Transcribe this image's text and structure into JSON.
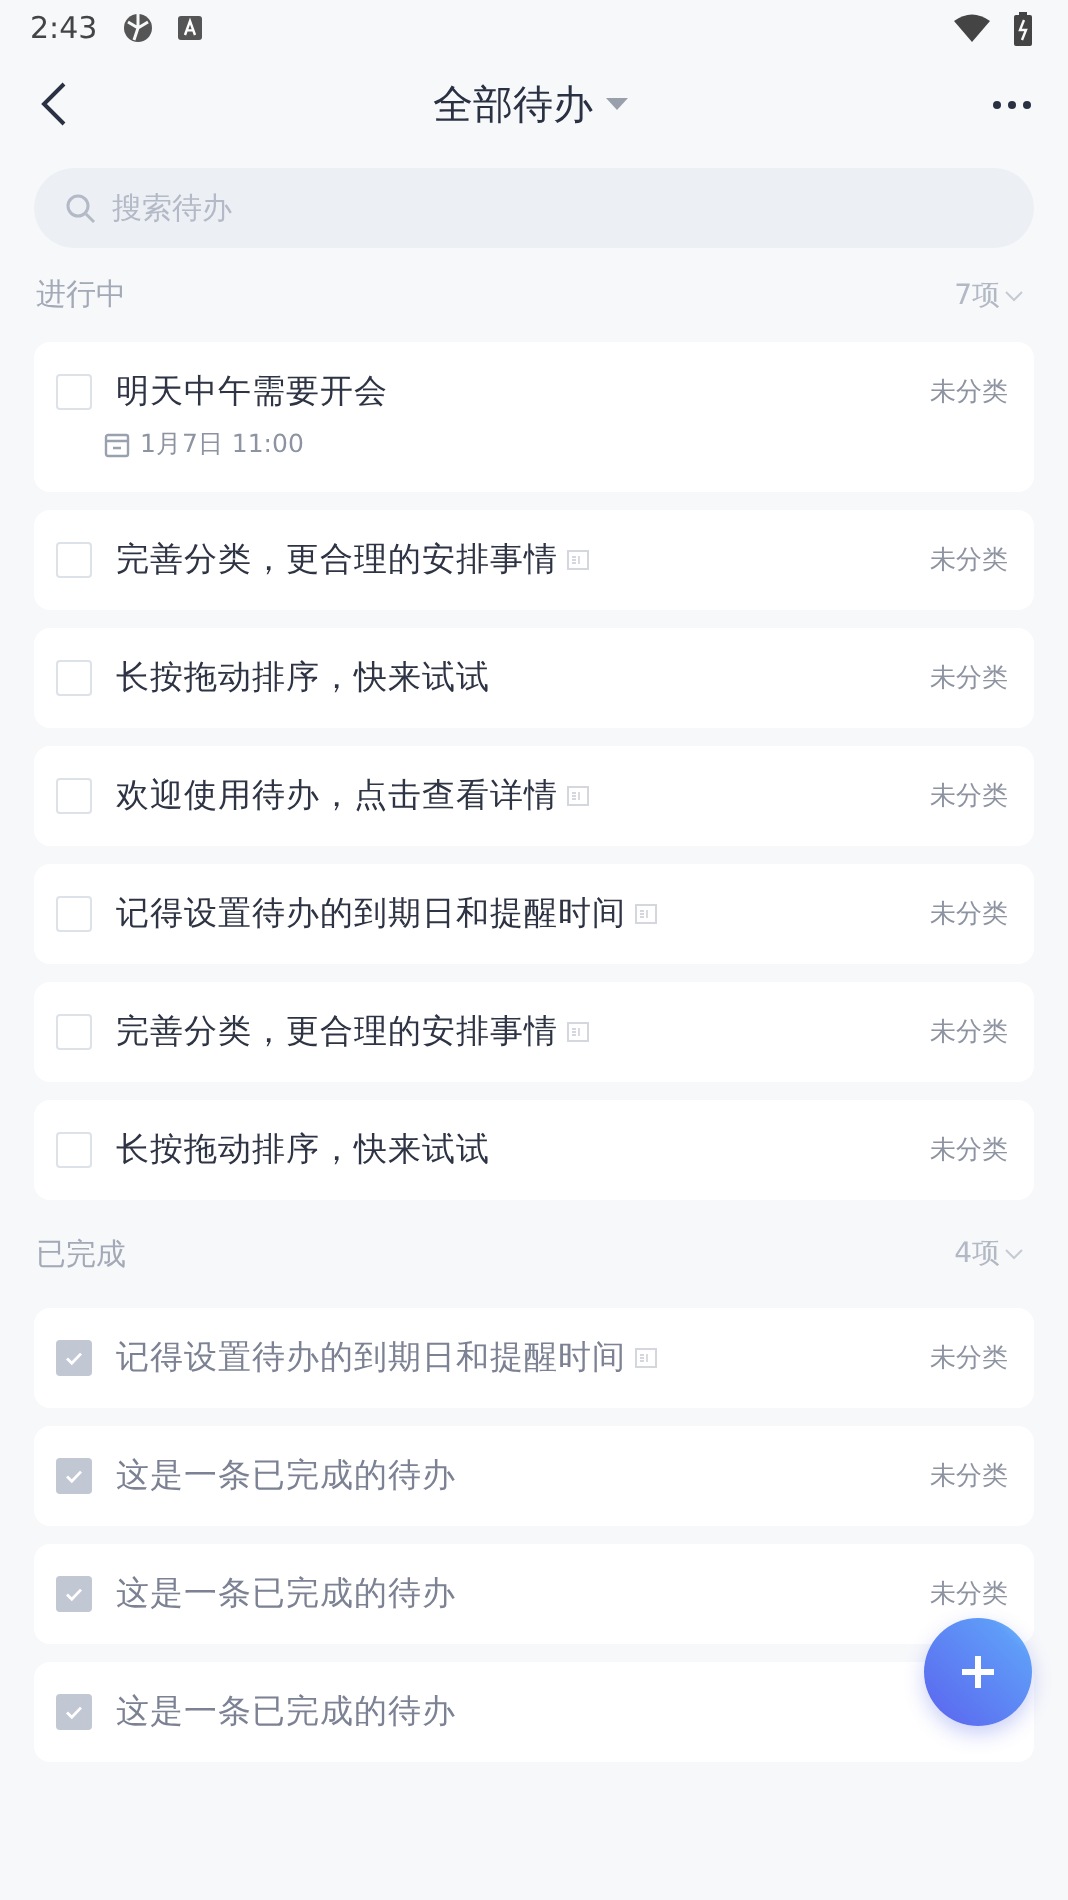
{
  "status_bar": {
    "time": "2:43"
  },
  "header": {
    "title": "全部待办"
  },
  "search": {
    "placeholder": "搜索待办"
  },
  "sections": [
    {
      "title": "进行中",
      "count": "7项",
      "items": [
        {
          "text": "明天中午需要开会",
          "category": "未分类",
          "checked": false,
          "has_note": false,
          "due": "1月7日 11:00"
        },
        {
          "text": "完善分类，更合理的安排事情",
          "category": "未分类",
          "checked": false,
          "has_note": true
        },
        {
          "text": "长按拖动排序，快来试试",
          "category": "未分类",
          "checked": false,
          "has_note": false
        },
        {
          "text": "欢迎使用待办，点击查看详情",
          "category": "未分类",
          "checked": false,
          "has_note": true
        },
        {
          "text": "记得设置待办的到期日和提醒时间",
          "category": "未分类",
          "checked": false,
          "has_note": true
        },
        {
          "text": "完善分类，更合理的安排事情",
          "category": "未分类",
          "checked": false,
          "has_note": true
        },
        {
          "text": "长按拖动排序，快来试试",
          "category": "未分类",
          "checked": false,
          "has_note": false
        }
      ]
    },
    {
      "title": "已完成",
      "count": "4项",
      "items": [
        {
          "text": "记得设置待办的到期日和提醒时间",
          "category": "未分类",
          "checked": true,
          "has_note": true
        },
        {
          "text": "这是一条已完成的待办",
          "category": "未分类",
          "checked": true,
          "has_note": false
        },
        {
          "text": "这是一条已完成的待办",
          "category": "未分类",
          "checked": true,
          "has_note": false
        },
        {
          "text": "这是一条已完成的待办",
          "checked": true,
          "has_note": false
        }
      ]
    }
  ]
}
